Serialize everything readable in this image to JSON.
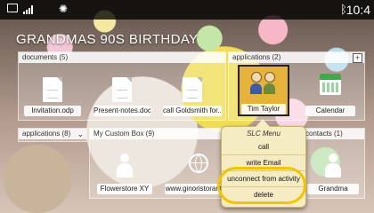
{
  "statusbar": {
    "icons": [
      "image-icon",
      "signal-icon",
      "brightness-icon",
      "bluetooth-icon"
    ],
    "time": "10:4"
  },
  "page": {
    "title": "GRANDMAS 90S BIRTHDAY"
  },
  "documents": {
    "header": "documents (5)",
    "items": [
      {
        "label": "Invitation.odp",
        "icon": "document-icon"
      },
      {
        "label": "Present-notes.doc",
        "icon": "document-icon"
      },
      {
        "label": "call Goldsmith for...",
        "icon": "document-icon"
      }
    ]
  },
  "applications_top": {
    "header": "applications (2)",
    "add_button": "+",
    "items": [
      {
        "label": "Tim Taylor",
        "icon": "contacts-icon"
      },
      {
        "label": "Calendar",
        "icon": "calendar-icon"
      }
    ]
  },
  "applications_collapsed": {
    "header": "applications (8)",
    "toggle": "⌄"
  },
  "custom_box": {
    "header": "My Custom Box (9)",
    "items": [
      {
        "label": "Flowerstore XY",
        "icon": "person-icon"
      },
      {
        "label": "www.ginoristorante...",
        "icon": "globe-icon"
      }
    ]
  },
  "contacts": {
    "header": "contacts (1)",
    "items": [
      {
        "label": "Grandma",
        "icon": "person-icon"
      }
    ]
  },
  "slc_menu": {
    "title": "SLC Menu",
    "items": [
      "call",
      "write Email",
      "unconnect from activity",
      "delete"
    ]
  },
  "colors": {
    "highlight_ring": "#f2c400",
    "selected_tile": "#e7b23a",
    "popup_bg": "#f5ecc4"
  }
}
